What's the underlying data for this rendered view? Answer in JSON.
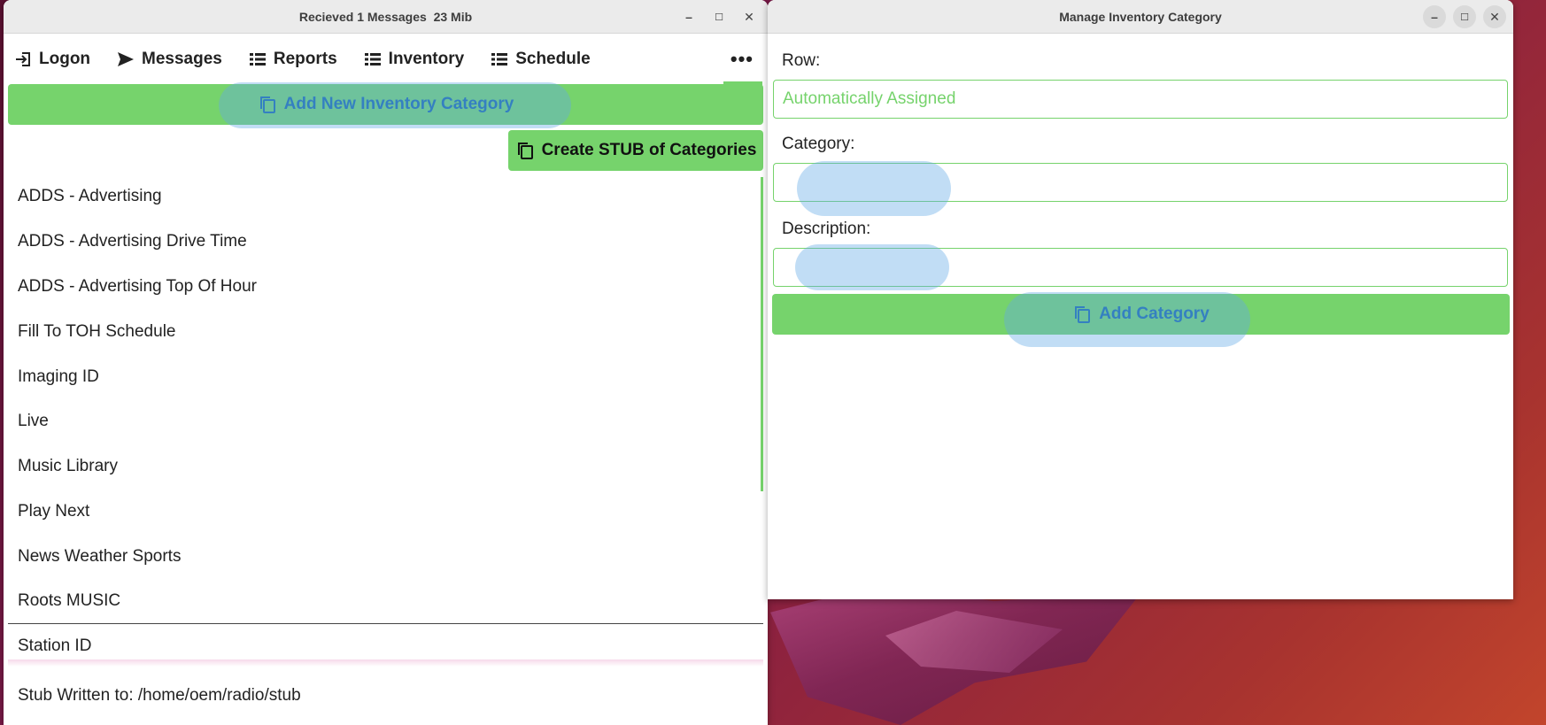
{
  "main_window": {
    "title": "Recieved 1 Messages  23 Mib",
    "nav": [
      {
        "label": "Logon",
        "icon": "logon-icon"
      },
      {
        "label": "Messages",
        "icon": "send-icon"
      },
      {
        "label": "Reports",
        "icon": "list-icon"
      },
      {
        "label": "Inventory",
        "icon": "list-icon"
      },
      {
        "label": "Schedule",
        "icon": "list-icon"
      }
    ],
    "more_label": "•••",
    "add_new_label": "Add New Inventory Category",
    "stub_label": "Create STUB of Categories",
    "categories": [
      "ADDS - Advertising",
      "ADDS - Advertising Drive Time",
      "ADDS - Advertising Top Of Hour",
      "Fill To TOH Schedule",
      "Imaging ID",
      "Live",
      "Music Library",
      "Play Next",
      "News Weather Sports",
      "Roots MUSIC",
      "Station ID"
    ],
    "status_text": "Stub Written to: /home/oem/radio/stub"
  },
  "dialog": {
    "title": "Manage Inventory Category",
    "row_label": "Row:",
    "row_placeholder": "Automatically Assigned",
    "category_label": "Category:",
    "category_value": "",
    "description_label": "Description:",
    "description_value": "",
    "add_button_label": "Add Category"
  },
  "colors": {
    "accent_green": "#76d36c",
    "highlight_blue": "#1565a8"
  }
}
